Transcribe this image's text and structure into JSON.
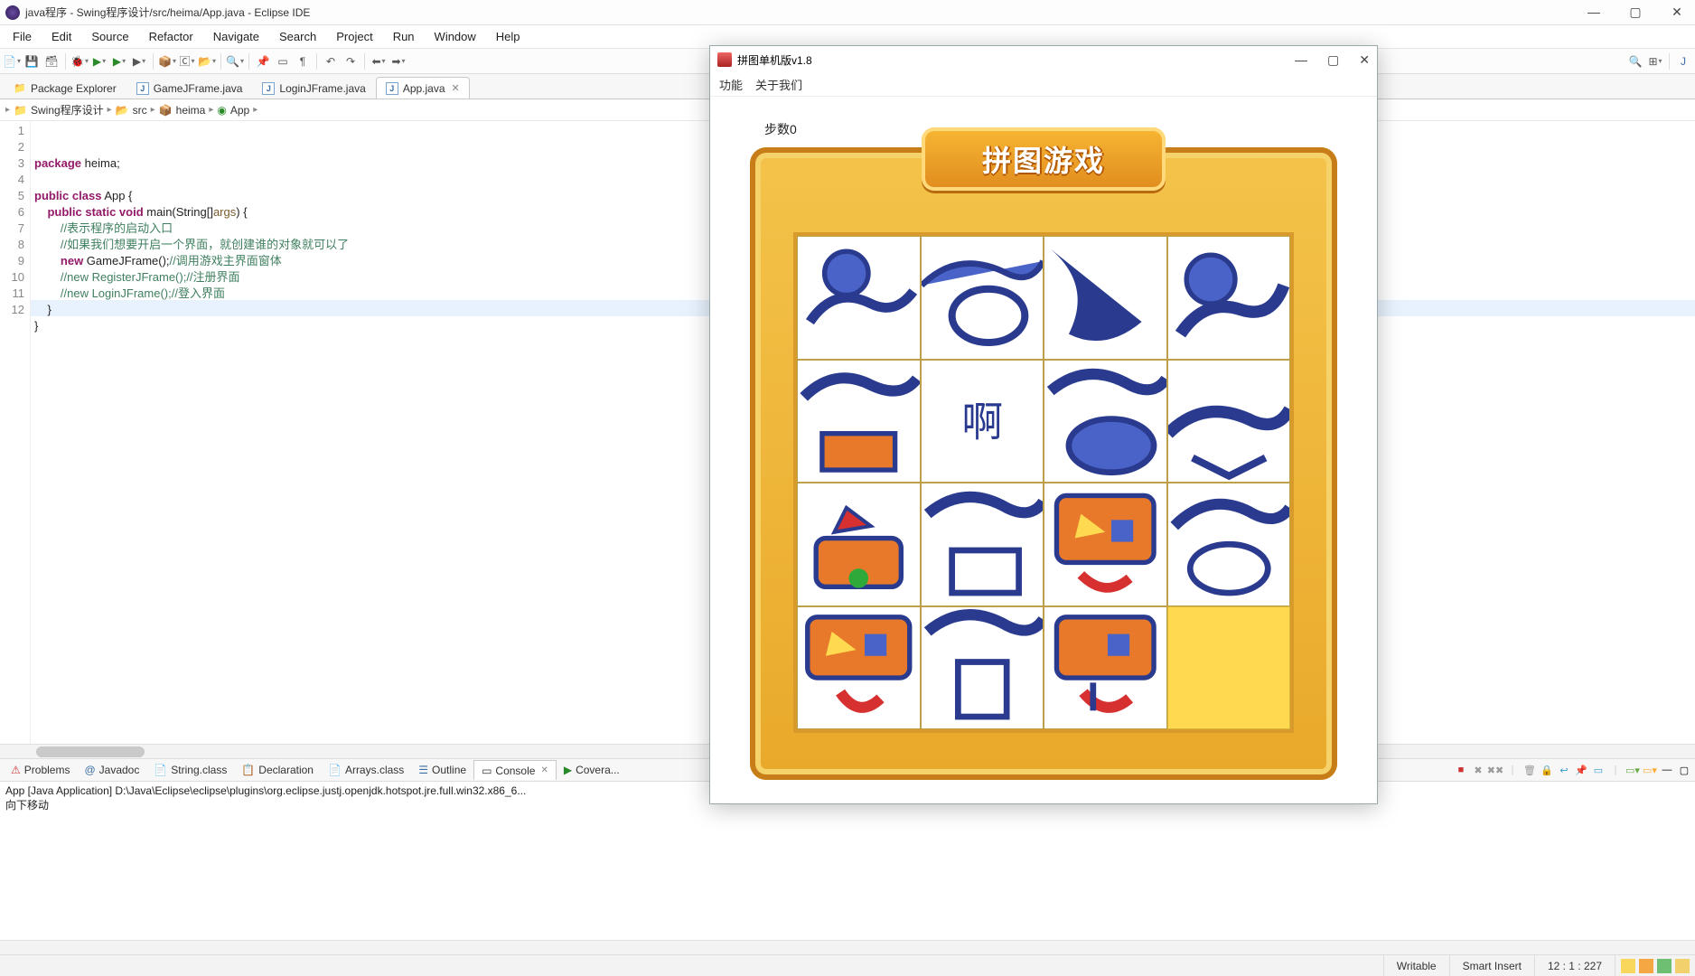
{
  "window": {
    "title": "java程序 - Swing程序设计/src/heima/App.java - Eclipse IDE",
    "min": "—",
    "max": "▢",
    "close": "✕"
  },
  "menubar": [
    "File",
    "Edit",
    "Source",
    "Refactor",
    "Navigate",
    "Search",
    "Project",
    "Run",
    "Window",
    "Help"
  ],
  "tabs": {
    "pkg": "Package Explorer",
    "t1": "GameJFrame.java",
    "t2": "LoginJFrame.java",
    "t3": "App.java"
  },
  "breadcrumb": {
    "b1": "Swing程序设计",
    "b2": "src",
    "b3": "heima",
    "b4": "App"
  },
  "gutter": [
    "1",
    "2",
    "3",
    "4",
    "5",
    "6",
    "7",
    "8",
    "9",
    "10",
    "11",
    "12"
  ],
  "code_lines": {
    "l1a": "package",
    "l1b": " heima;",
    "l3a": "public class",
    "l3b": " App {",
    "l4a": "    public static void",
    "l4b": " main(String[]",
    "l4c": "args",
    "l4d": ") {",
    "l5": "        //表示程序的启动入口",
    "l6": "        //如果我们想要开启一个界面，就创建谁的对象就可以了",
    "l7a": "        new",
    "l7b": " GameJFrame();",
    "l7c": "//调用游戏主界面窗体",
    "l8": "        //new RegisterJFrame();//注册界面",
    "l9": "        //new LoginJFrame();//登入界面",
    "l10": "    }",
    "l11": "}"
  },
  "bottom_tabs": {
    "problems": "Problems",
    "javadoc": "Javadoc",
    "string": "String.class",
    "decl": "Declaration",
    "arrays": "Arrays.class",
    "outline": "Outline",
    "console": "Console",
    "covera": "Covera..."
  },
  "console": {
    "line1": "App [Java Application] D:\\Java\\Eclipse\\eclipse\\plugins\\org.eclipse.justj.openjdk.hotspot.jre.full.win32.x86_6...",
    "line2": "向下移动"
  },
  "status": {
    "writable": "Writable",
    "insert": "Smart Insert",
    "pos": "12 : 1 : 227"
  },
  "game": {
    "title": "拼图单机版v1.8",
    "menu1": "功能",
    "menu2": "关于我们",
    "steps_label": "步数",
    "steps_value": "0",
    "banner": "拼图游戏",
    "min": "—",
    "max": "▢",
    "close": "✕"
  }
}
